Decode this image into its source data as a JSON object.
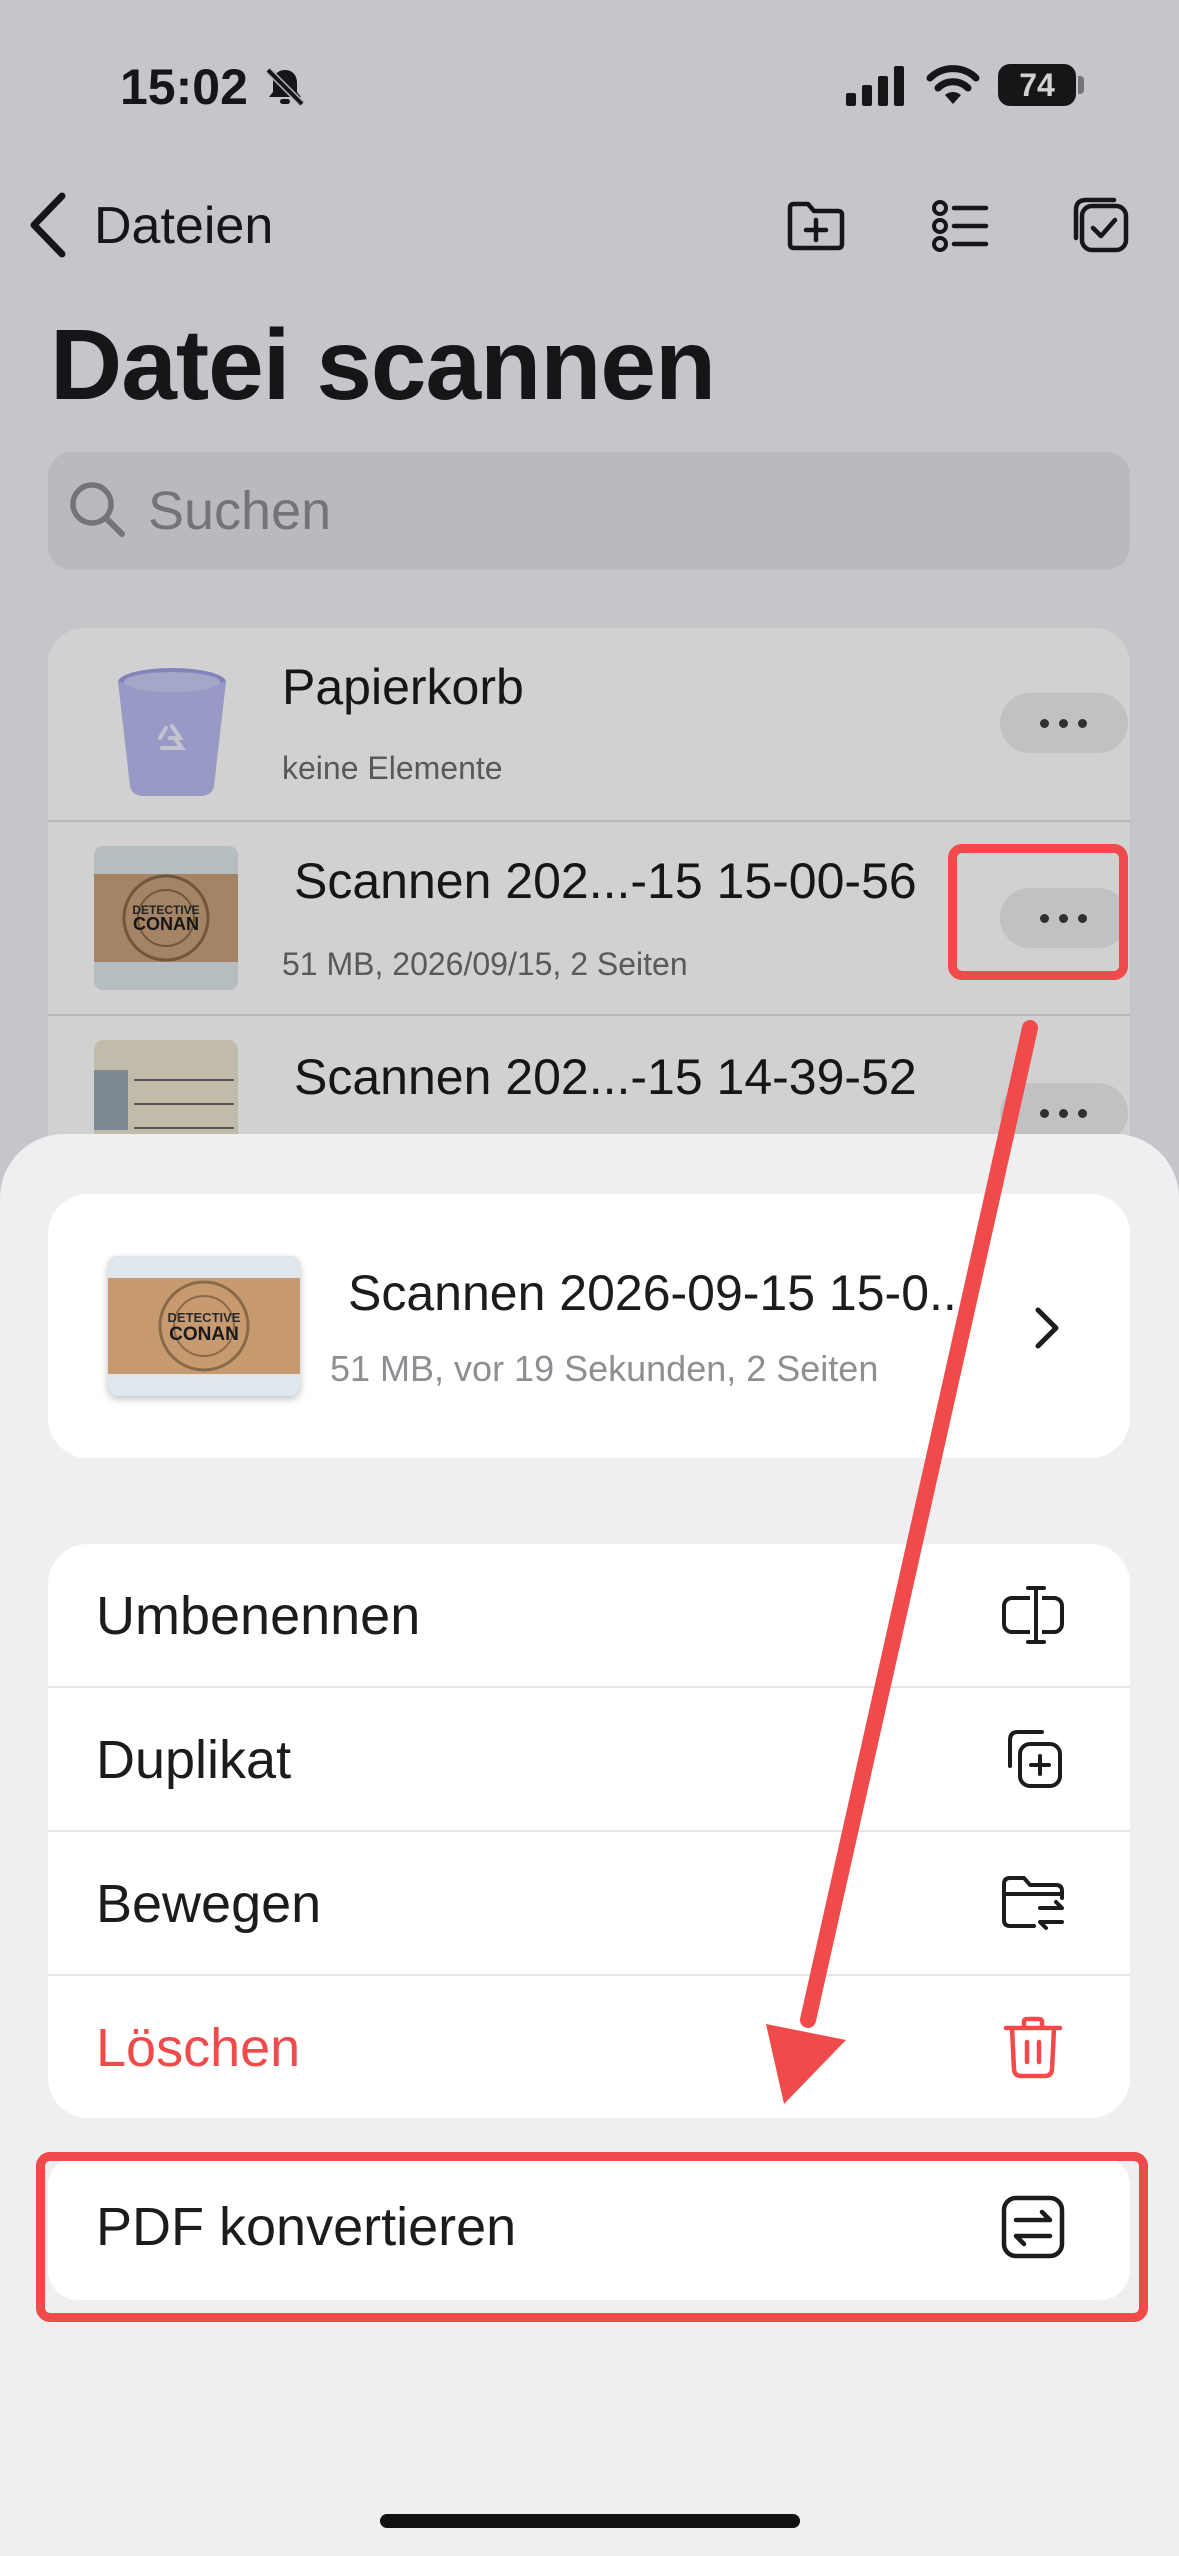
{
  "status_bar": {
    "time": "15:02",
    "battery": "74"
  },
  "nav": {
    "back_label": "Dateien"
  },
  "page": {
    "title": "Datei scannen"
  },
  "search": {
    "placeholder": "Suchen"
  },
  "file_list": [
    {
      "title": "Papierkorb",
      "subtitle": "keine Elemente"
    },
    {
      "title": "Scannen 202...-15 15-00-56",
      "subtitle": "51 MB, 2026/09/15, 2 Seiten"
    },
    {
      "title": "Scannen 202...-15 14-39-52",
      "subtitle": ""
    }
  ],
  "thumbnail_text": {
    "line1": "DETECTIVE",
    "line2": "CONAN"
  },
  "sheet": {
    "preview_title": "Scannen 2026-09-15 15-0...",
    "preview_subtitle": "51 MB, vor 19 Sekunden, 2 Seiten",
    "actions": [
      {
        "label": "Umbenennen",
        "icon": "rename-icon"
      },
      {
        "label": "Duplikat",
        "icon": "duplicate-icon"
      },
      {
        "label": "Bewegen",
        "icon": "move-folder-icon"
      },
      {
        "label": "Löschen",
        "icon": "trash-icon"
      }
    ],
    "convert_label": "PDF konvertieren"
  },
  "colors": {
    "destructive": "#f04a4a",
    "annotation": "#f04a4a",
    "trash_bin": "#b8bcf0"
  }
}
